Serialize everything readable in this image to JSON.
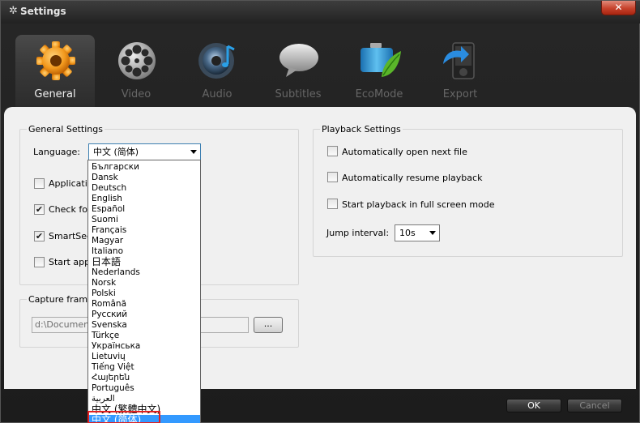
{
  "window": {
    "title": "Settings",
    "close_label": "✕"
  },
  "tabs": [
    {
      "label": "General",
      "icon": "gear-icon",
      "active": true
    },
    {
      "label": "Video",
      "icon": "film-reel-icon"
    },
    {
      "label": "Audio",
      "icon": "speaker-icon"
    },
    {
      "label": "Subtitles",
      "icon": "speech-bubble-icon"
    },
    {
      "label": "EcoMode",
      "icon": "battery-leaf-icon"
    },
    {
      "label": "Export",
      "icon": "export-device-icon"
    }
  ],
  "general": {
    "legend": "General Settings",
    "language_label": "Language:",
    "language_value": "中文 (简体)",
    "checkboxes": [
      {
        "label": "Applicatio",
        "checked": false
      },
      {
        "label": "Check for",
        "checked": true
      },
      {
        "label": "SmartSeel",
        "checked": true
      },
      {
        "label": "Start appl",
        "checked": false
      }
    ]
  },
  "capture": {
    "legend": "Capture frame",
    "path_value": "d:\\Documen",
    "browse_label": "..."
  },
  "playback": {
    "legend": "Playback Settings",
    "checkboxes": [
      {
        "label": "Automatically open next file",
        "checked": false
      },
      {
        "label": "Automatically resume playback",
        "checked": false
      },
      {
        "label": "Start playback in full screen mode",
        "checked": false
      }
    ],
    "jump_label": "Jump interval:",
    "jump_value": "10s"
  },
  "languages": [
    "Български",
    "Dansk",
    "Deutsch",
    "English",
    "Español",
    "Suomi",
    "Français",
    "Magyar",
    "Italiano",
    "日本語",
    "Nederlands",
    "Norsk",
    "Polski",
    "Română",
    "Русский",
    "Svenska",
    "Türkçe",
    "Українська",
    "Lietuvių",
    "Tiếng Việt",
    "Հայերեն",
    "Português",
    "العربية",
    "中文 (繁體中文)",
    "中文 (简体)"
  ],
  "selected_language_index": 24,
  "footer": {
    "ok_label": "OK",
    "cancel_label": "Cancel"
  },
  "colors": {
    "accent_selected": "#3399ff",
    "highlight_box": "#e02020",
    "window_dark": "#1c1c1c",
    "panel": "#f0f0f0"
  }
}
